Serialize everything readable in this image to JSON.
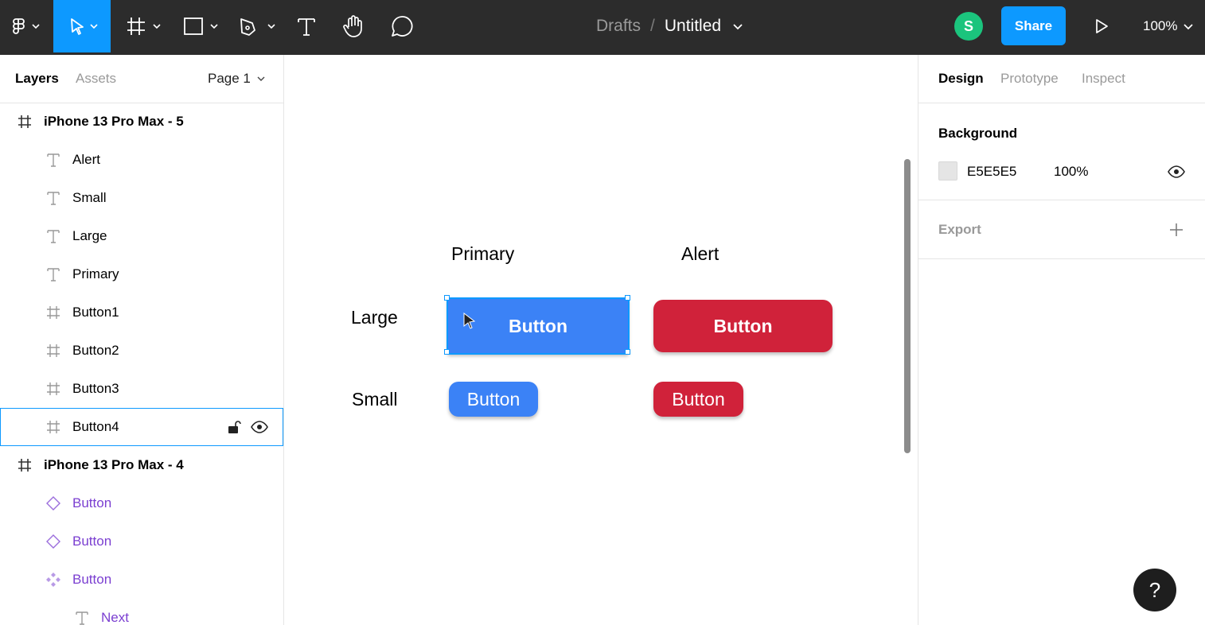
{
  "toolbar": {
    "breadcrumb_folder": "Drafts",
    "breadcrumb_separator": "/",
    "file_name": "Untitled",
    "avatar_initial": "S",
    "share_label": "Share",
    "zoom": "100%",
    "icons": [
      "figma-menu-icon",
      "move-tool-icon",
      "frame-tool-icon",
      "rectangle-tool-icon",
      "pen-tool-icon",
      "text-tool-icon",
      "hand-tool-icon",
      "comment-tool-icon",
      "play-icon"
    ],
    "accent": "#0d99ff"
  },
  "layers_panel": {
    "tabs": [
      "Layers",
      "Assets"
    ],
    "page": "Page 1",
    "layers": [
      {
        "name": "iPhone 13 Pro Max - 5",
        "type": "frame"
      },
      {
        "name": "Alert",
        "type": "text"
      },
      {
        "name": "Small",
        "type": "text"
      },
      {
        "name": "Large",
        "type": "text"
      },
      {
        "name": "Primary",
        "type": "text"
      },
      {
        "name": "Button1",
        "type": "frame"
      },
      {
        "name": "Button2",
        "type": "frame"
      },
      {
        "name": "Button3",
        "type": "frame"
      },
      {
        "name": "Button4",
        "type": "frame",
        "selected": true
      },
      {
        "name": "iPhone 13 Pro Max - 4",
        "type": "frame"
      },
      {
        "name": "Button",
        "type": "variant"
      },
      {
        "name": "Button",
        "type": "variant"
      },
      {
        "name": "Button",
        "type": "component-set"
      },
      {
        "name": "Next",
        "type": "text"
      }
    ]
  },
  "canvas": {
    "column_primary": "Primary",
    "column_alert": "Alert",
    "row_large": "Large",
    "row_small": "Small",
    "buttons": {
      "large_primary": "Button",
      "large_alert": "Button",
      "small_primary": "Button",
      "small_alert": "Button"
    },
    "colors": {
      "primary": "#3b82f6",
      "alert": "#d0223a"
    }
  },
  "design_panel": {
    "tabs": [
      "Design",
      "Prototype",
      "Inspect"
    ],
    "background_title": "Background",
    "background_hex": "E5E5E5",
    "background_opacity": "100%",
    "background_color": "#e5e5e5",
    "export_title": "Export"
  },
  "help_label": "?"
}
